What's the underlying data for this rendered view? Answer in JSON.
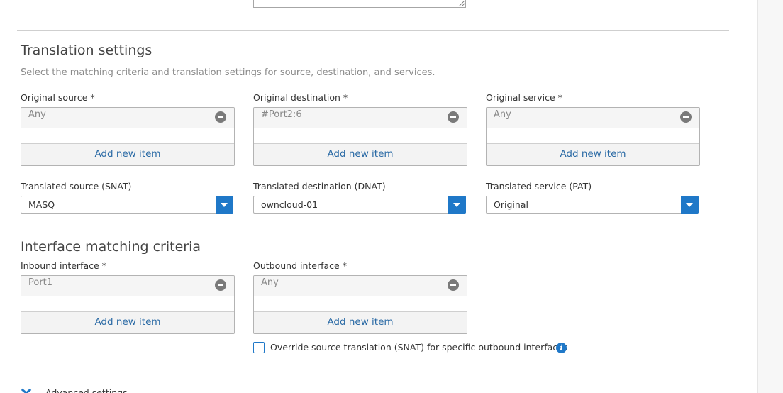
{
  "translation": {
    "title": "Translation settings",
    "description": "Select the matching criteria and translation settings for source, destination, and services.",
    "original_source": {
      "label": "Original source *",
      "item": "Any",
      "add_label": "Add new item"
    },
    "original_destination": {
      "label": "Original destination *",
      "item": "#Port2:6",
      "add_label": "Add new item"
    },
    "original_service": {
      "label": "Original service *",
      "item": "Any",
      "add_label": "Add new item"
    },
    "translated_source": {
      "label": "Translated source (SNAT)",
      "value": "MASQ"
    },
    "translated_destination": {
      "label": "Translated destination (DNAT)",
      "value": "owncloud-01"
    },
    "translated_service": {
      "label": "Translated service (PAT)",
      "value": "Original"
    }
  },
  "interface": {
    "title": "Interface matching criteria",
    "inbound": {
      "label": "Inbound interface *",
      "item": "Port1",
      "add_label": "Add new item"
    },
    "outbound": {
      "label": "Outbound interface *",
      "item": "Any",
      "add_label": "Add new item"
    },
    "override_snat_label": "Override source translation (SNAT) for specific outbound interfaces",
    "info_glyph": "i"
  },
  "advanced": {
    "label": "Advanced settings"
  },
  "icons": {
    "remove": "minus-circle-icon",
    "dropdown": "caret-down-icon",
    "info": "info-icon",
    "expand": "chevron-down-icon"
  },
  "colors": {
    "accent": "#1f78c8",
    "link": "#2a6aa5"
  }
}
